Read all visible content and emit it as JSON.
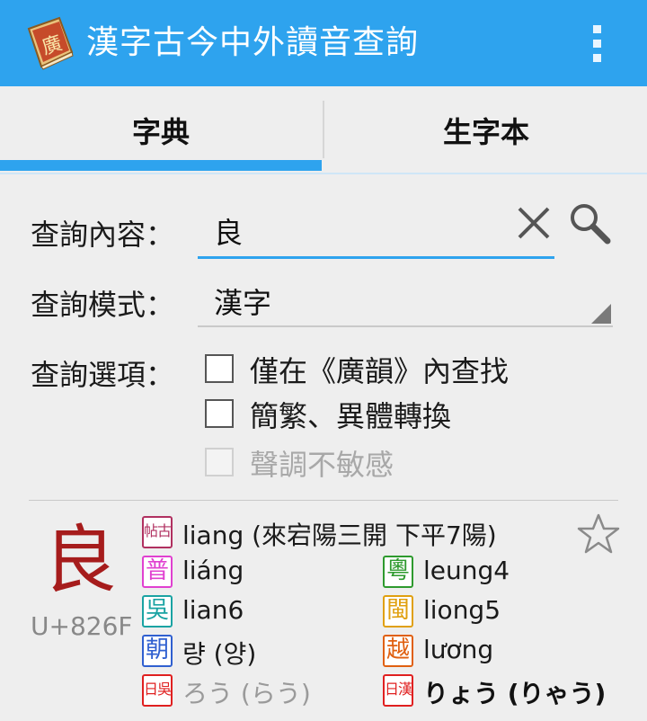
{
  "app": {
    "title": "漢字古今中外讀音查詢",
    "icon": "book-icon",
    "icon_glyph": "廣",
    "menu_icon": "overflow-menu-icon"
  },
  "tabs": [
    {
      "label": "字典",
      "selected": true
    },
    {
      "label": "生字本",
      "selected": false
    }
  ],
  "form": {
    "query_label": "查詢內容：",
    "query_value": "良",
    "mode_label": "查詢模式：",
    "mode_value": "漢字",
    "options_label": "查詢選項：",
    "options": [
      {
        "label": "僅在《廣韻》內查找",
        "checked": false,
        "enabled": true
      },
      {
        "label": "簡繁、異體轉換",
        "checked": false,
        "enabled": true
      },
      {
        "label": "聲調不敏感",
        "checked": false,
        "enabled": false
      }
    ]
  },
  "colors": {
    "accent": "#2ea3ee",
    "char": "#a61c1c"
  },
  "result": {
    "character": "良",
    "codepoint": "U+826F",
    "favorite_icon": "star-outline-icon",
    "readings": [
      {
        "badge": "帖古",
        "color": "#b03060",
        "text": "liang (來宕陽三開 下平7陽)"
      },
      {
        "badge": "普",
        "color": "#e040d0",
        "text": "liáng"
      },
      {
        "badge": "粵",
        "color": "#2e9a2e",
        "text": "leung4"
      },
      {
        "badge": "吳",
        "color": "#1aa3a3",
        "text": "lian6"
      },
      {
        "badge": "閩",
        "color": "#e0a010",
        "text": "liong5"
      },
      {
        "badge": "朝",
        "color": "#3060d0",
        "text": "량 (양)"
      },
      {
        "badge": "越",
        "color": "#e06010",
        "text": "lương"
      },
      {
        "badge": "日吳",
        "color": "#e02020",
        "text": "ろう (らう)"
      },
      {
        "badge": "日漢",
        "color": "#e02020",
        "text": "りょう (りゃう)"
      }
    ]
  }
}
